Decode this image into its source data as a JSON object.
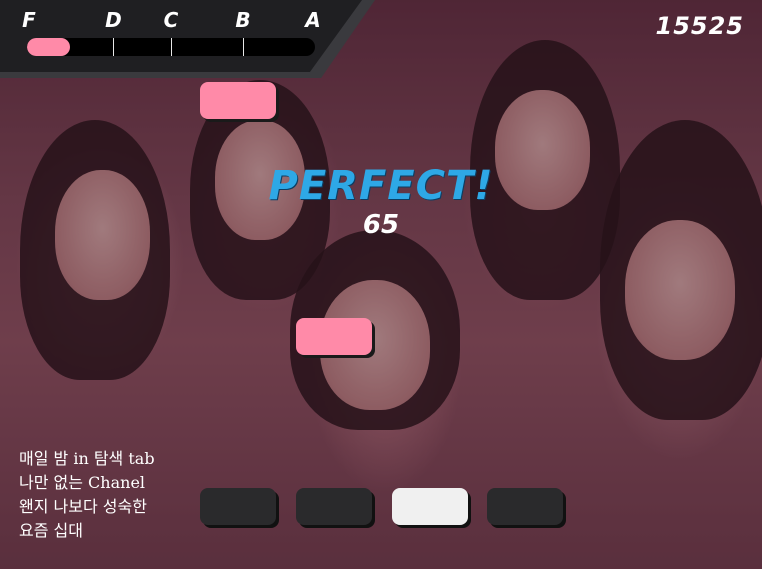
{
  "grades": [
    {
      "label": "F",
      "pos": 0
    },
    {
      "label": "D",
      "pos": 30
    },
    {
      "label": "C",
      "pos": 50
    },
    {
      "label": "B",
      "pos": 75
    },
    {
      "label": "A",
      "pos": 100
    }
  ],
  "progress_fraction": 0.15,
  "score": "15525",
  "judgement": "PERFECT!",
  "combo": "65",
  "lyrics": [
    "매일 밤 in 탐색 tab",
    "나만 없는 Chanel",
    "왠지 나보다 성숙한",
    "요즘 십대"
  ],
  "lanes": [
    {
      "name": "lane-1",
      "active": false
    },
    {
      "name": "lane-2",
      "active": false
    },
    {
      "name": "lane-3",
      "active": true
    },
    {
      "name": "lane-4",
      "active": false
    }
  ],
  "falling_notes": [
    {
      "lane": 1
    },
    {
      "lane": 2
    }
  ],
  "colors": {
    "note": "#ff8aa8",
    "judgement": "#2ea8e6",
    "key_idle": "#2a2a2c",
    "key_active": "#f0f0f0"
  }
}
